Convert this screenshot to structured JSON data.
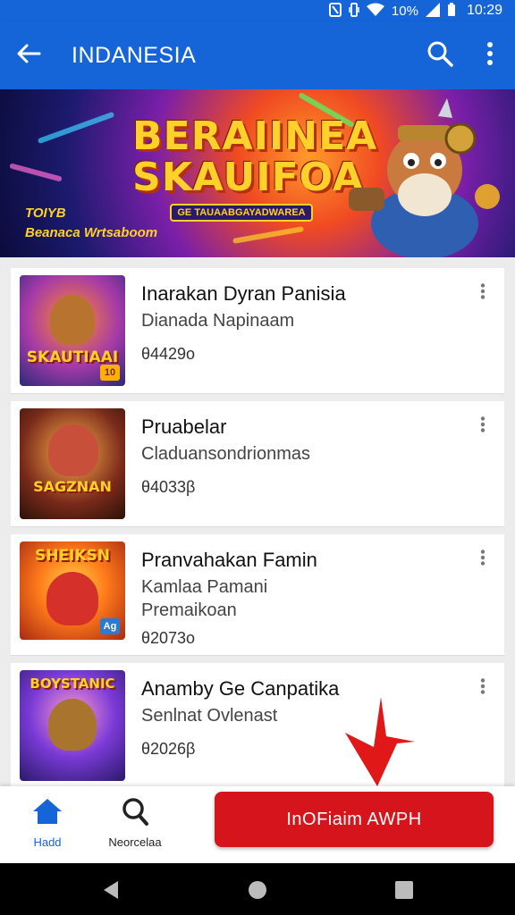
{
  "status_bar": {
    "time": "10:29",
    "battery_text": "10%",
    "icons": [
      "nfc-icon",
      "vibrate-icon",
      "wifi-icon",
      "battery-icon"
    ]
  },
  "app_bar": {
    "title": "INDANESIA",
    "back_icon": "arrow-left-icon",
    "search_icon": "search-icon",
    "more_icon": "more-vertical-icon"
  },
  "banner": {
    "title_line1": "BERAIINEA",
    "title_line2": "SKAUIFOA",
    "ribbon": "GE TAUAABGAYADWAREA",
    "left_line1": "TOIYB",
    "left_line2": "Beanaca Wrtsaboom"
  },
  "games": [
    {
      "name": "Inarakan Dyran Panisia",
      "subtitle": "Dianada Napinaam",
      "subtitle2": "",
      "price": "θ4429o",
      "thumb_text": "SKAUTIAAI",
      "badge": "10"
    },
    {
      "name": "Pruabelar",
      "subtitle": "Claduansondrionmas",
      "subtitle2": "",
      "price": "θ4033β",
      "thumb_text": "SAGZNAN",
      "badge": ""
    },
    {
      "name": "Pranvahakan Famin",
      "subtitle": "Kamlaa Pamani",
      "subtitle2": "Premaikoan",
      "price": "θ2073o",
      "thumb_text": "SHEIKSN",
      "badge": "Ag"
    },
    {
      "name": "Anamby Ge Canpatika",
      "subtitle": "Senlnat Ovlenast",
      "subtitle2": "",
      "price": "θ2026β",
      "thumb_text": "BOYSTANIC",
      "badge": ""
    }
  ],
  "bottom_nav": {
    "home_label": "Hadd",
    "search_label": "Neorcelaa",
    "cta_label": "InOFiaim AWPH"
  },
  "colors": {
    "primary": "#1565d8",
    "cta": "#d6141c",
    "accent_gold": "#ffd12a"
  }
}
